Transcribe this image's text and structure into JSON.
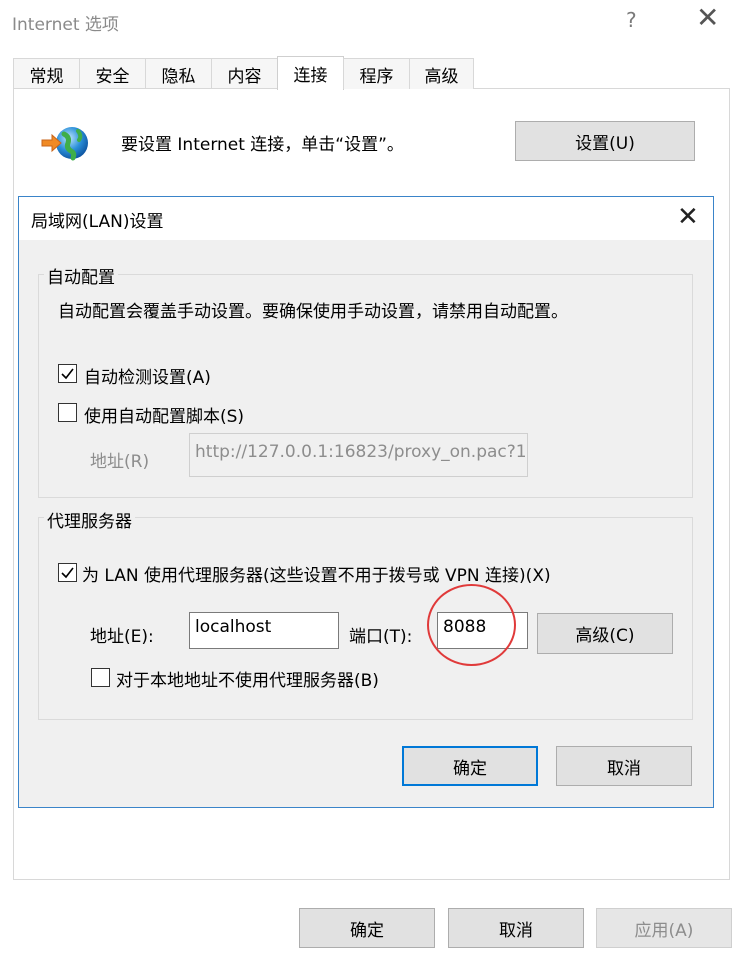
{
  "window": {
    "title": "Internet 选项",
    "help_glyph": "?",
    "close_glyph": "✕"
  },
  "tabs": [
    "常规",
    "安全",
    "隐私",
    "内容",
    "连接",
    "程序",
    "高级"
  ],
  "active_tab": "连接",
  "connection": {
    "intro_text": "要设置 Internet 连接，单击“设置”。",
    "setup_button": "设置(U)"
  },
  "lan_dialog": {
    "title": "局域网(LAN)设置",
    "close_glyph": "✕",
    "auto_config": {
      "legend": "自动配置",
      "description": "自动配置会覆盖手动设置。要确保使用手动设置，请禁用自动配置。",
      "auto_detect": {
        "label": "自动检测设置(A)",
        "checked": true
      },
      "use_script": {
        "label": "使用自动配置脚本(S)",
        "checked": false
      },
      "address_label": "地址(R)",
      "address_value": "http://127.0.0.1:16823/proxy_on.pac?1"
    },
    "proxy": {
      "legend": "代理服务器",
      "use_proxy": {
        "label": "为 LAN 使用代理服务器(这些设置不用于拨号或 VPN 连接)(X)",
        "checked": true
      },
      "address_label": "地址(E):",
      "address_value": "localhost",
      "port_label": "端口(T):",
      "port_value": "8088",
      "advanced_button": "高级(C)",
      "bypass_local": {
        "label": "对于本地地址不使用代理服务器(B)",
        "checked": false
      }
    },
    "ok_button": "确定",
    "cancel_button": "取消"
  },
  "footer": {
    "ok_button": "确定",
    "cancel_button": "取消",
    "apply_button": "应用(A)"
  },
  "colors": {
    "accent": "#0078d7",
    "dialog_border": "#3a84c9",
    "annotation_ring": "#e03a3a"
  }
}
